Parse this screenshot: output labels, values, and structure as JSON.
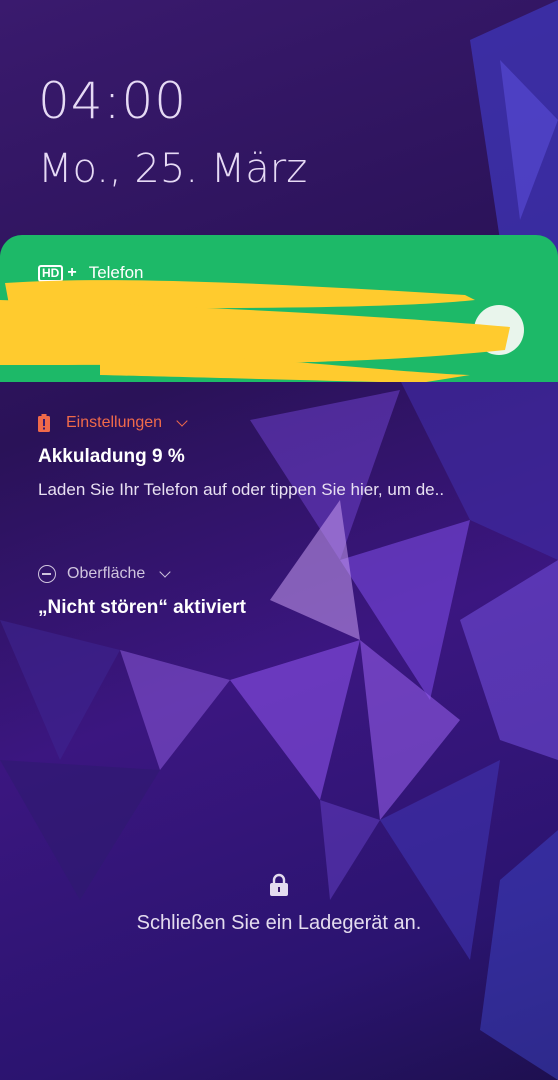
{
  "lockscreen": {
    "time": "04:00",
    "date": "Mo., 25. März",
    "unlock_hint": "Schließen Sie ein Ladegerät an."
  },
  "call": {
    "app_label": "Telefon",
    "hd_badge": "HD",
    "hd_plus": "+",
    "accent_color": "#1db968"
  },
  "notifications": [
    {
      "app": "Einstellungen",
      "title": "Akkuladung 9 %",
      "body": "Laden Sie Ihr Telefon auf oder tippen Sie hier, um de..",
      "icon": "battery-warning-icon",
      "app_color": "#f06a4a"
    },
    {
      "app": "Oberfläche",
      "title": "„Nicht stören“ aktiviert",
      "icon": "do-not-disturb-icon",
      "app_color": "#cfc4de"
    }
  ]
}
